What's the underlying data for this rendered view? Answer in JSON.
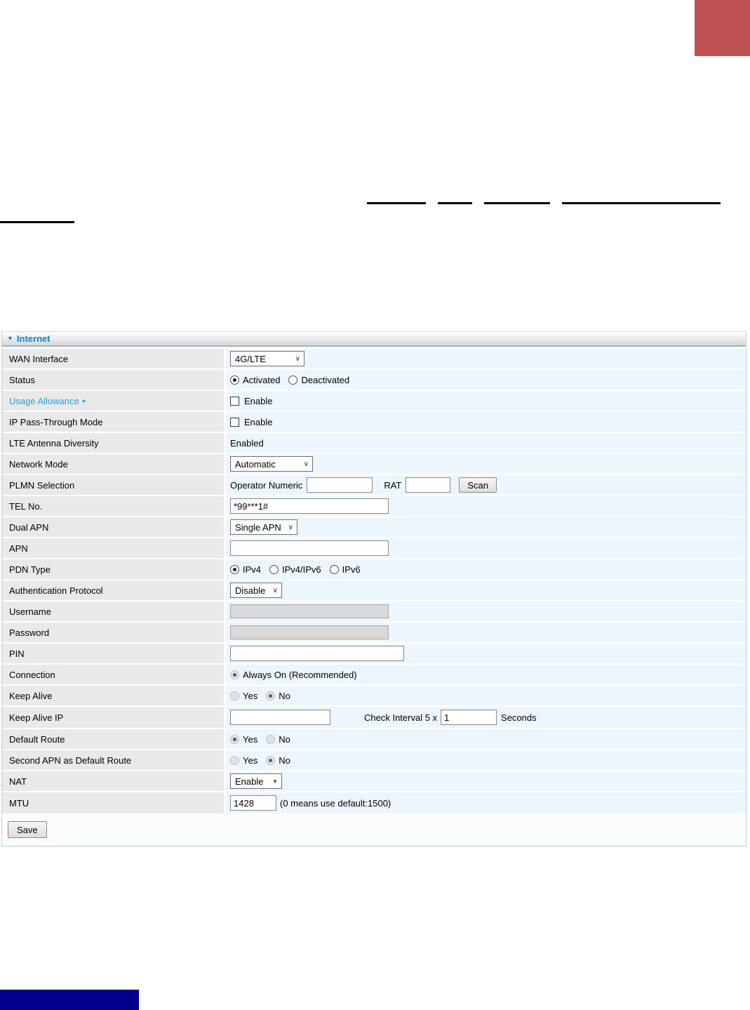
{
  "decor": {
    "top_right_block_color": "#c05152",
    "bottom_left_block_color": "#00008b",
    "underline_color": "#000000"
  },
  "icons": {
    "collapse": "▼",
    "link_arrow": "▸",
    "select_chevron": "∨",
    "nat_select_arrow": "▼"
  },
  "panel": {
    "title": "Internet"
  },
  "rows": [
    {
      "label": "WAN Interface",
      "value": "4G/LTE"
    },
    {
      "label": "Status",
      "opt1": "Activated",
      "opt2": "Deactivated"
    },
    {
      "label": "Usage Allowance",
      "enable_label": "Enable"
    },
    {
      "label": "IP Pass-Through Mode",
      "enable_label": "Enable"
    },
    {
      "label": "LTE Antenna Diversity",
      "value": "Enabled"
    },
    {
      "label": "Network Mode",
      "value": "Automatic"
    },
    {
      "label": "PLMN Selection",
      "operator_label": "Operator Numeric",
      "rat_label": "RAT",
      "scan_label": "Scan"
    },
    {
      "label": "TEL No.",
      "value": "*99***1#"
    },
    {
      "label": "Dual APN",
      "value": "Single APN"
    },
    {
      "label": "APN",
      "value": ""
    },
    {
      "label": "PDN Type",
      "opt1": "IPv4",
      "opt2": "IPv4/IPv6",
      "opt3": "IPv6"
    },
    {
      "label": "Authentication Protocol",
      "value": "Disable"
    },
    {
      "label": "Username",
      "value": ""
    },
    {
      "label": "Password",
      "value": ""
    },
    {
      "label": "PIN",
      "value": ""
    },
    {
      "label": "Connection",
      "opt1": "Always On (Recommended)"
    },
    {
      "label": "Keep Alive",
      "opt1": "Yes",
      "opt2": "No"
    },
    {
      "label": "Keep Alive IP",
      "value": "",
      "interval_label": "Check Interval 5 x",
      "interval_value": "1",
      "seconds_label": "Seconds"
    },
    {
      "label": "Default Route",
      "opt1": "Yes",
      "opt2": "No"
    },
    {
      "label": "Second APN as Default Route",
      "opt1": "Yes",
      "opt2": "No"
    },
    {
      "label": "NAT",
      "value": "Enable"
    },
    {
      "label": "MTU",
      "value": "1428",
      "hint": "(0 means use default:1500)"
    }
  ],
  "save_button": {
    "label": "Save"
  }
}
